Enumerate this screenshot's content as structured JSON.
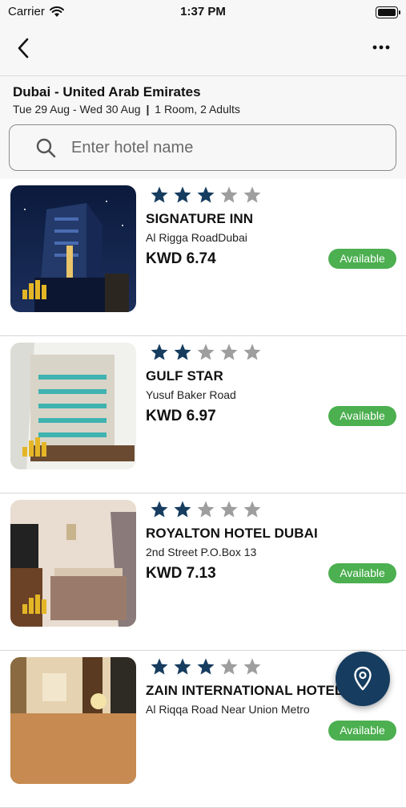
{
  "status_bar": {
    "carrier": "Carrier",
    "time": "1:37 PM"
  },
  "nav": {
    "back_icon": "chevron-left-icon",
    "more_icon": "more-horizontal-icon"
  },
  "search": {
    "location": "Dubai - United Arab Emirates",
    "dates": "Tue 29 Aug - Wed 30 Aug",
    "separator": "|",
    "occupancy": "1 Room, 2 Adults",
    "placeholder": "Enter hotel name"
  },
  "colors": {
    "star_filled": "#163c5f",
    "star_empty": "#9e9e9e",
    "available": "#4caf50",
    "fab": "#163c5f"
  },
  "hotels": [
    {
      "name": "SIGNATURE INN",
      "address": "Al Rigga RoadDubai",
      "price": "KWD 6.74",
      "status": "Available",
      "stars": 3
    },
    {
      "name": "GULF STAR",
      "address": "Yusuf Baker Road",
      "price": "KWD 6.97",
      "status": "Available",
      "stars": 2
    },
    {
      "name": "ROYALTON HOTEL DUBAI",
      "address": "2nd Street P.O.Box 13",
      "price": "KWD 7.13",
      "status": "Available",
      "stars": 2
    },
    {
      "name": "ZAIN INTERNATIONAL HOTEL",
      "address": "Al Riqqa Road Near Union Metro",
      "price": "",
      "status": "Available",
      "stars": 3
    }
  ]
}
